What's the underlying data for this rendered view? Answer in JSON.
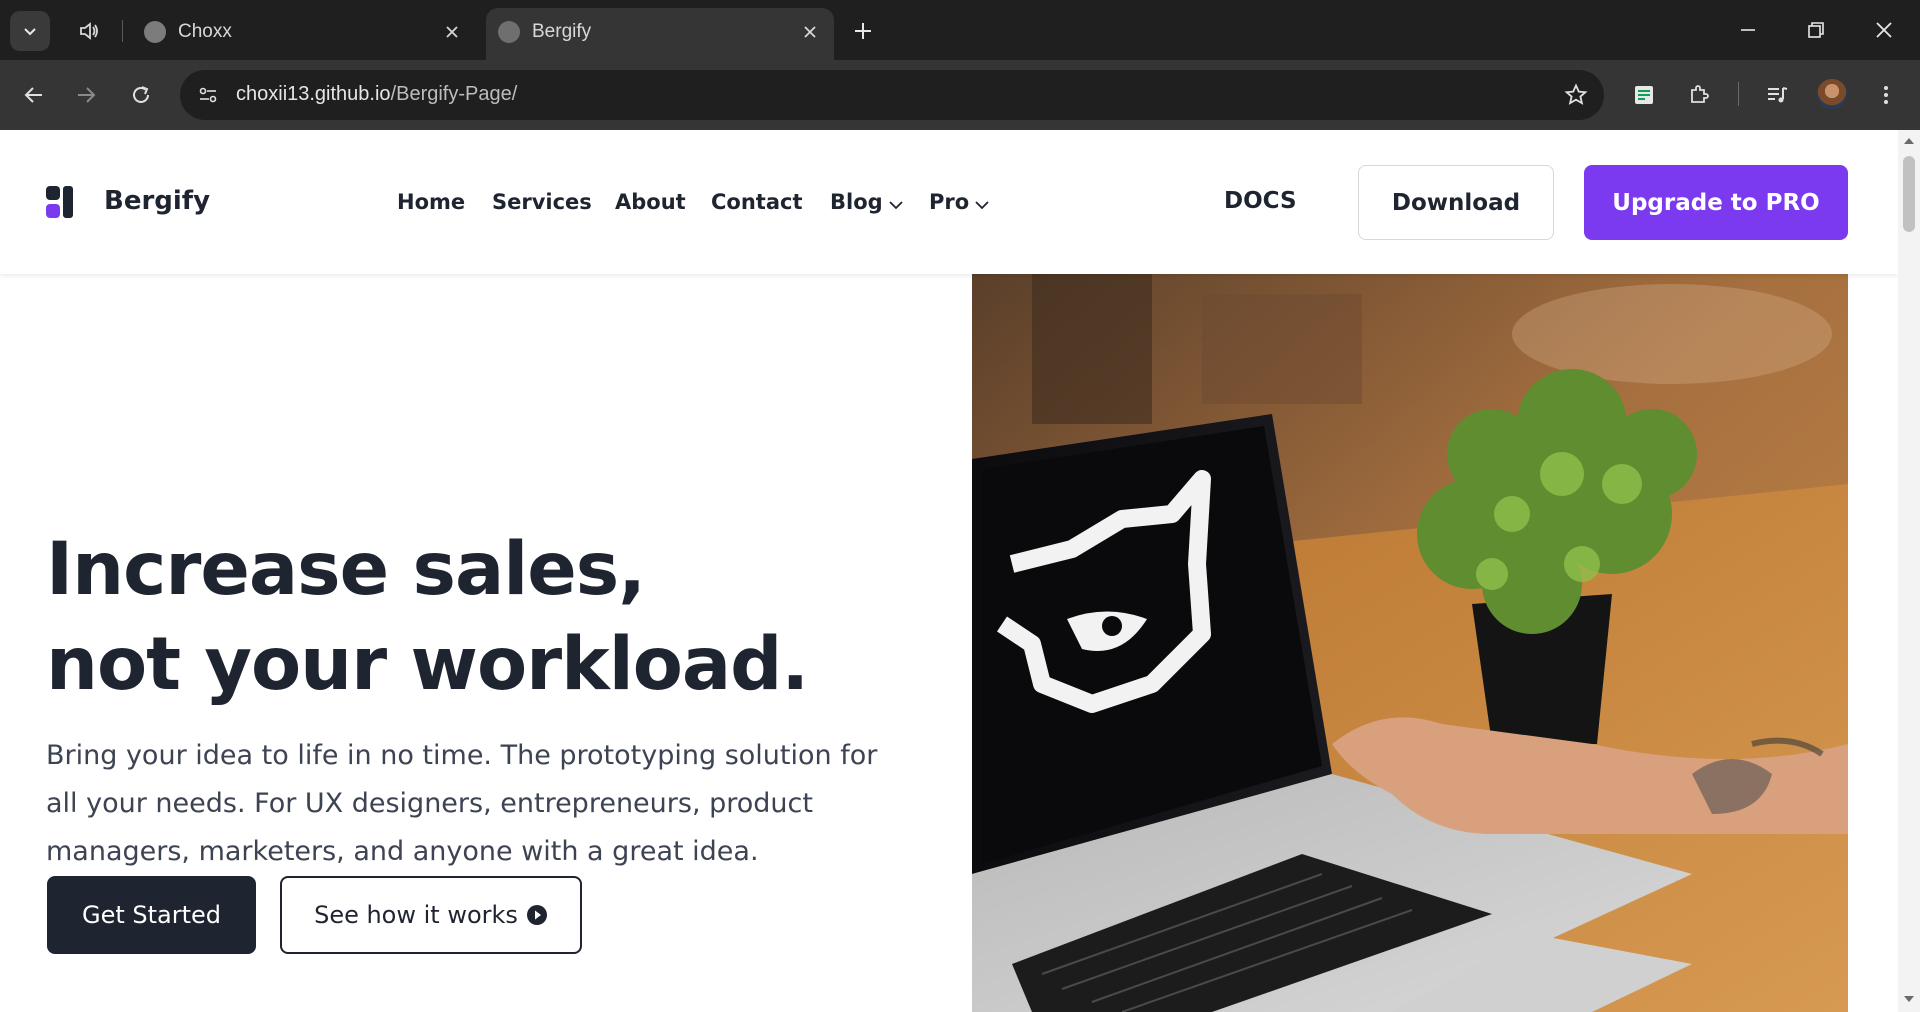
{
  "browser": {
    "tabs": [
      {
        "title": "Choxx",
        "active": false
      },
      {
        "title": "Bergify",
        "active": true
      }
    ],
    "url_host": "choxii13.github.io",
    "url_path": "/Bergify-Page/"
  },
  "header": {
    "brand": "Bergify",
    "nav": {
      "home": "Home",
      "services": "Services",
      "about": "About",
      "contact": "Contact",
      "blog": "Blog",
      "pro": "Pro"
    },
    "docs": "DOCS",
    "download": "Download",
    "upgrade": "Upgrade to PRO"
  },
  "hero": {
    "title_line1": "Increase sales,",
    "title_line2": "not your workload.",
    "subtitle": "Bring your idea to life in no time. The prototyping solution for all your needs. For UX designers, entrepreneurs, product managers, marketers, and anyone with a great idea.",
    "primary_cta": "Get Started",
    "secondary_cta": "See how it works"
  },
  "colors": {
    "accent": "#7b3af0",
    "dark": "#1e2430",
    "chrome_bg": "#1f1f1f",
    "chrome_toolbar": "#353535"
  }
}
